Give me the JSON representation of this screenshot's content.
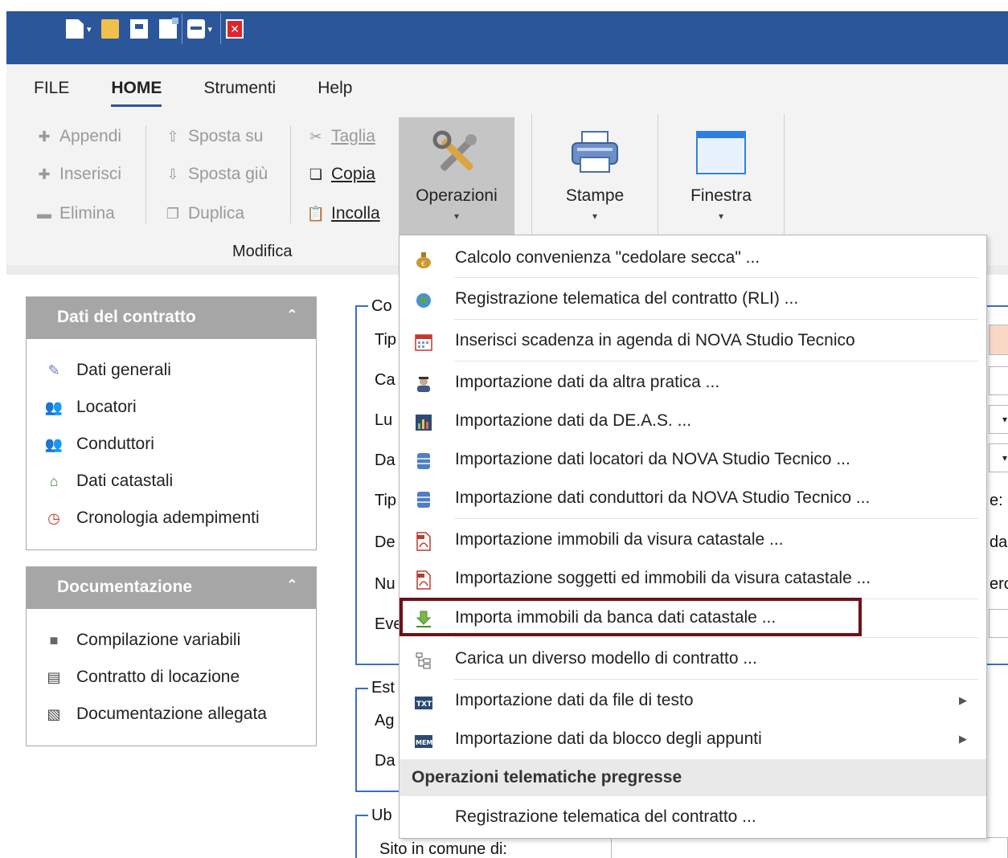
{
  "ribbon": {
    "tabs": [
      "FILE",
      "HOME",
      "Strumenti",
      "Help"
    ],
    "modifica": {
      "col1": [
        "Appendi",
        "Inserisci",
        "Elimina"
      ],
      "col2": [
        "Sposta su",
        "Sposta giù",
        "Duplica"
      ],
      "col3": [
        "Taglia",
        "Copia",
        "Incolla"
      ],
      "group_label": "Modifica"
    },
    "big": {
      "operazioni": "Operazioni",
      "stampe": "Stampe",
      "finestra": "Finestra",
      "arrow": "▾"
    }
  },
  "panels": {
    "contratto": {
      "title": "Dati del contratto",
      "chevron": "⌃",
      "items": [
        "Dati generali",
        "Locatori",
        "Conduttori",
        "Dati catastali",
        "Cronologia adempimenti"
      ]
    },
    "documentazione": {
      "title": "Documentazione",
      "chevron": "⌃",
      "items": [
        "Compilazione variabili",
        "Contratto di locazione",
        "Documentazione allegata"
      ]
    }
  },
  "form": {
    "group1": "Co",
    "labels": [
      "Tip",
      "Ca",
      "Lu",
      "Da",
      "Tip",
      "De",
      "Nu",
      "Eve"
    ],
    "right_fragments": [
      "e:",
      "da t",
      "ero"
    ],
    "group2": "Est",
    "labels2": [
      "Ag",
      "Da"
    ],
    "group3": "Ub",
    "site_label": "Sito in comune di:"
  },
  "menu": {
    "items": [
      "Calcolo convenienza \"cedolare secca\" ...",
      "Registrazione telematica del contratto (RLI) ...",
      "Inserisci scadenza in agenda di NOVA Studio Tecnico",
      "Importazione dati da altra pratica ...",
      "Importazione dati da DE.A.S. ...",
      "Importazione dati locatori da NOVA Studio Tecnico ...",
      "Importazione dati conduttori da NOVA Studio Tecnico ...",
      "Importazione immobili da visura catastale ...",
      "Importazione soggetti ed immobili da visura catastale ...",
      "Importa immobili da banca dati catastale ...",
      "Carica un diverso modello di contratto ...",
      "Importazione dati da file di testo",
      "Importazione dati da blocco degli appunti"
    ],
    "submenu_arrow": "▶",
    "section_header": "Operazioni telematiche pregresse",
    "section_items": [
      "Registrazione telematica del contratto ..."
    ],
    "icon_txt": "TXT",
    "icon_mem": "MEM"
  },
  "colors": {
    "titlebar": "#2b579a",
    "highlight": "#6d1218",
    "panel_header": "#a6a6a6"
  }
}
